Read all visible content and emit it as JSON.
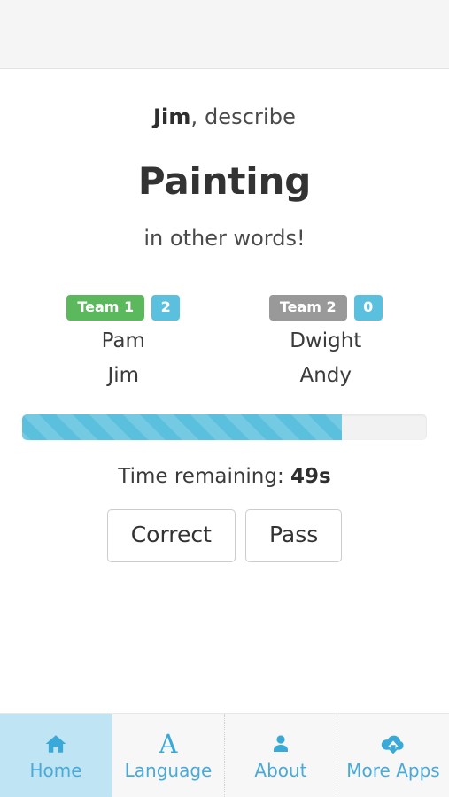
{
  "header": {
    "title": ""
  },
  "round": {
    "prompt_player": "Jim",
    "prompt_verb": ", describe",
    "word": "Painting",
    "prompt_suffix": "in other words!"
  },
  "teams": [
    {
      "label": "Team 1",
      "score": "2",
      "label_color": "#5cb85c",
      "score_color": "#5bc0de",
      "members": [
        "Pam",
        "Jim"
      ]
    },
    {
      "label": "Team 2",
      "score": "0",
      "label_color": "#999999",
      "score_color": "#5bc0de",
      "members": [
        "Dwight",
        "Andy"
      ]
    }
  ],
  "progress": {
    "percent": 79,
    "fill_color": "#5bc0de",
    "track_color": "#f2f2f2"
  },
  "timer": {
    "label": "Time remaining: ",
    "value": "49s"
  },
  "actions": {
    "correct_label": "Correct",
    "pass_label": "Pass"
  },
  "bottom_nav": {
    "items": [
      {
        "label": "Home",
        "icon": "home-icon",
        "active": true
      },
      {
        "label": "Language",
        "icon": "letter-a-icon",
        "active": false
      },
      {
        "label": "About",
        "icon": "person-icon",
        "active": false
      },
      {
        "label": "More Apps",
        "icon": "cloud-download-icon",
        "active": false
      }
    ],
    "active_color": "#bfe5f5",
    "icon_color": "#3aa9d8",
    "label_color": "#49a9d9"
  }
}
